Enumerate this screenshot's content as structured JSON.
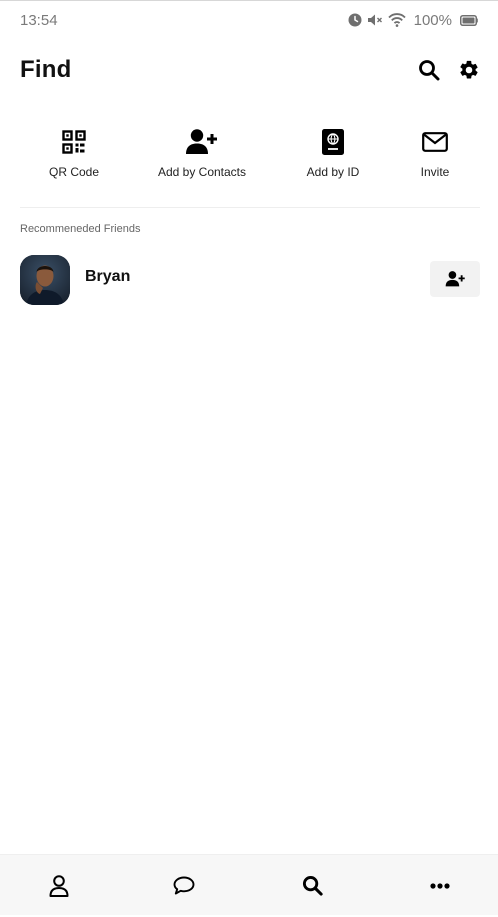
{
  "status_bar": {
    "time": "13:54",
    "battery_percent": "100%",
    "icons": [
      "alarm-icon",
      "mute-icon",
      "wifi-icon",
      "battery-icon"
    ]
  },
  "header": {
    "title": "Find",
    "actions": [
      "search-icon",
      "gear-icon"
    ]
  },
  "quick_actions": [
    {
      "label": "QR Code",
      "icon": "qr-code-icon"
    },
    {
      "label": "Add by Contacts",
      "icon": "user-plus-icon"
    },
    {
      "label": "Add by ID",
      "icon": "id-card-icon"
    },
    {
      "label": "Invite",
      "icon": "envelope-icon"
    }
  ],
  "recommended": {
    "section_label": "Recommeneded Friends",
    "friends": [
      {
        "name": "Bryan",
        "action_icon": "user-plus-icon"
      }
    ]
  },
  "bottom_nav": [
    {
      "icon": "person-icon",
      "active": false
    },
    {
      "icon": "chat-bubble-icon",
      "active": false
    },
    {
      "icon": "search-icon",
      "active": true
    },
    {
      "icon": "more-dots-icon",
      "active": false
    }
  ],
  "colors": {
    "text_primary": "#111111",
    "status_gray": "#7a7a7a",
    "section_gray": "#666666",
    "nav_background": "#f7f7f7",
    "button_background": "#f2f2f2"
  }
}
